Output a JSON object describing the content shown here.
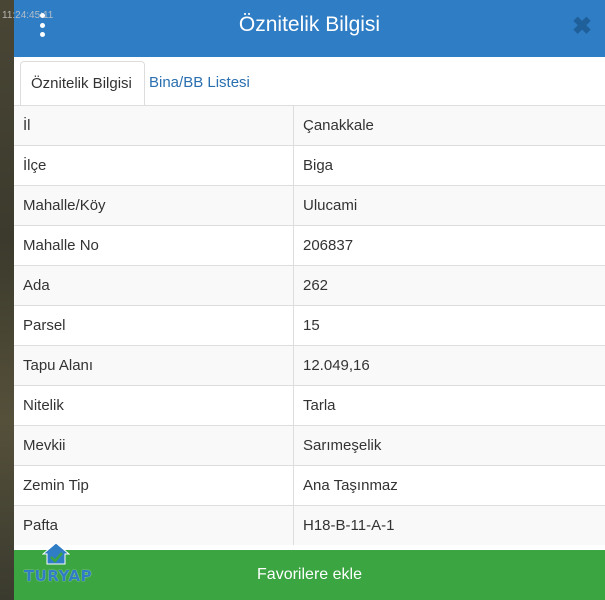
{
  "background": {
    "overlay_text": "11:24:45:11"
  },
  "header": {
    "title": "Öznitelik Bilgisi",
    "menu_icon": "kebab-menu-icon",
    "close_icon": "close-icon",
    "color": "#2f7dc4"
  },
  "tabs": [
    {
      "label": "Öznitelik Bilgisi",
      "active": true
    },
    {
      "label": "Bina/BB Listesi",
      "active": false
    }
  ],
  "attributes": [
    {
      "key": "İl",
      "value": "Çanakkale"
    },
    {
      "key": "İlçe",
      "value": "Biga"
    },
    {
      "key": "Mahalle/Köy",
      "value": "Ulucami"
    },
    {
      "key": "Mahalle No",
      "value": "206837"
    },
    {
      "key": "Ada",
      "value": "262"
    },
    {
      "key": "Parsel",
      "value": "15"
    },
    {
      "key": "Tapu Alanı",
      "value": "12.049,16"
    },
    {
      "key": "Nitelik",
      "value": "Tarla"
    },
    {
      "key": "Mevkii",
      "value": "Sarımeşelik"
    },
    {
      "key": "Zemin Tip",
      "value": "Ana Taşınmaz"
    },
    {
      "key": "Pafta",
      "value": "H18-B-11-A-1"
    }
  ],
  "footer": {
    "button_label": "Favorilere ekle",
    "color": "#3aa541"
  },
  "logo": {
    "text": "TURYAP",
    "icon": "turyap-house-logo-icon"
  }
}
